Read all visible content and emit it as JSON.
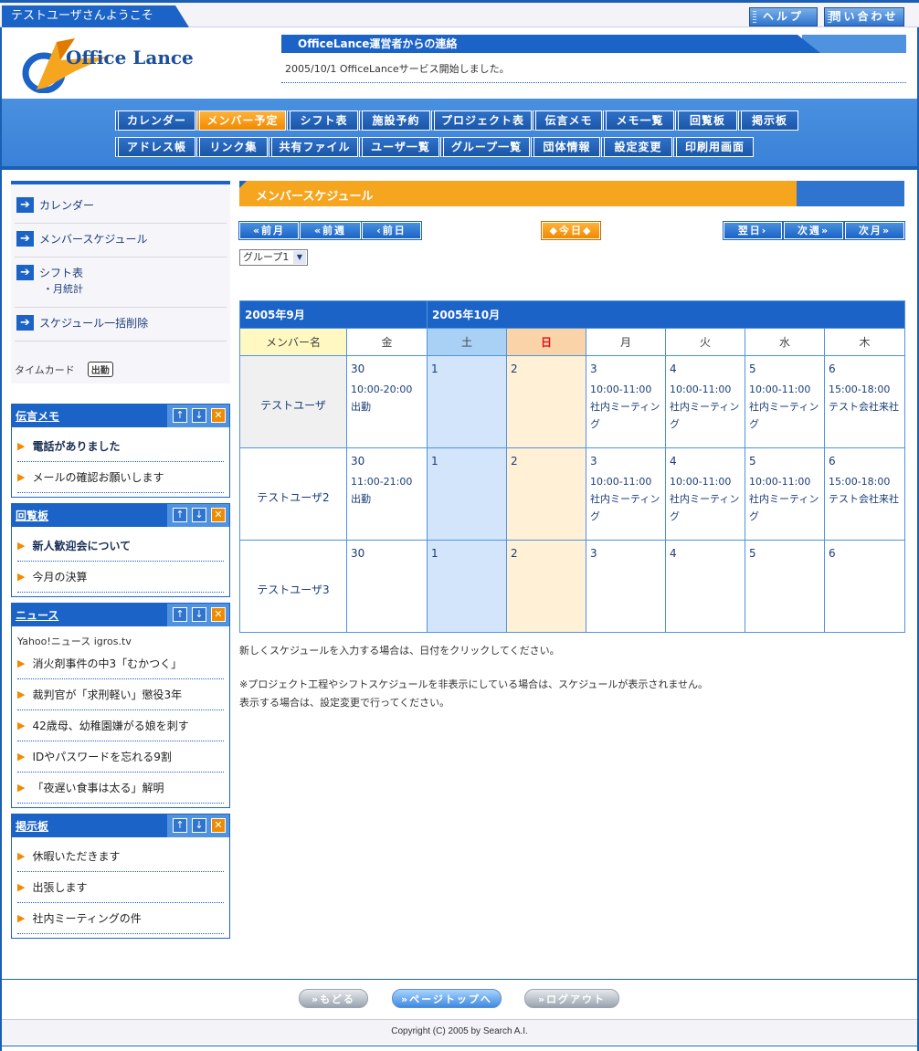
{
  "topbar": {
    "welcome": "テストユーザさんようこそ",
    "help_label": "ヘルプ",
    "contact_label": "問い合わせ"
  },
  "header": {
    "logo_text": "Office Lance",
    "notice_title": "OfficeLance運営者からの連絡",
    "notice_text": "2005/10/1 OfficeLanceサービス開始しました。"
  },
  "nav": {
    "row1": [
      "カレンダー",
      "メンバー予定",
      "シフト表",
      "施設予約",
      "プロジェクト表",
      "伝言メモ",
      "メモ一覧",
      "回覧板",
      "掲示板"
    ],
    "row2": [
      "アドレス帳",
      "リンク集",
      "共有ファイル",
      "ユーザ一覧",
      "グループ一覧",
      "団体情報",
      "設定変更",
      "印刷用画面"
    ],
    "active": "メンバー予定"
  },
  "sidebar": {
    "links": [
      {
        "label": "カレンダー"
      },
      {
        "label": "メンバースケジュール"
      },
      {
        "label": "シフト表",
        "sub": "・月統計"
      },
      {
        "label": "スケジュール一括削除"
      }
    ],
    "timecard_label": "タイムカード",
    "timecard_button": "出勤",
    "panels": [
      {
        "title": "伝言メモ",
        "items": [
          {
            "text": "電話がありました",
            "bold": true
          },
          {
            "text": "メールの確認お願いします",
            "bold": false
          }
        ]
      },
      {
        "title": "回覧板",
        "items": [
          {
            "text": "新人歓迎会について",
            "bold": true
          },
          {
            "text": "今月の決算",
            "bold": false
          }
        ]
      },
      {
        "title": "ニュース",
        "source": "Yahoo!ニュース igros.tv",
        "items": [
          {
            "text": "消火剤事件の中3「むかつく」",
            "bold": false
          },
          {
            "text": "裁判官が「求刑軽い」懲役3年",
            "bold": false
          },
          {
            "text": "42歳母、幼稚園嫌がる娘を刺す",
            "bold": false
          },
          {
            "text": "IDやパスワードを忘れる9割",
            "bold": false
          },
          {
            "text": "「夜遅い食事は太る」解明",
            "bold": false
          }
        ]
      },
      {
        "title": "掲示板",
        "items": [
          {
            "text": "休暇いただきます",
            "bold": false
          },
          {
            "text": "出張します",
            "bold": false
          },
          {
            "text": "社内ミーティングの件",
            "bold": false
          }
        ]
      }
    ]
  },
  "main": {
    "title": "メンバースケジュール",
    "pager": {
      "prev_month": "前月",
      "prev_week": "前週",
      "prev_day": "前日",
      "today": "今日",
      "next_day": "翌日",
      "next_week": "次週",
      "next_month": "次月"
    },
    "group_select": "グループ1",
    "table": {
      "month1": "2005年9月",
      "month2": "2005年10月",
      "name_header": "メンバー名",
      "days": [
        "金",
        "土",
        "日",
        "月",
        "火",
        "水",
        "木"
      ],
      "rows": [
        {
          "name": "テストユーザ",
          "cells": [
            {
              "d": "30",
              "e": "10:00-20:00 出勤"
            },
            {
              "d": "1",
              "e": ""
            },
            {
              "d": "2",
              "e": ""
            },
            {
              "d": "3",
              "e": "10:00-11:00 社内ミーティング"
            },
            {
              "d": "4",
              "e": "10:00-11:00 社内ミーティング"
            },
            {
              "d": "5",
              "e": "10:00-11:00 社内ミーティング"
            },
            {
              "d": "6",
              "e": "15:00-18:00 テスト会社来社"
            }
          ]
        },
        {
          "name": "テストユーザ2",
          "cells": [
            {
              "d": "30",
              "e": "11:00-21:00 出勤"
            },
            {
              "d": "1",
              "e": ""
            },
            {
              "d": "2",
              "e": ""
            },
            {
              "d": "3",
              "e": "10:00-11:00 社内ミーティング"
            },
            {
              "d": "4",
              "e": "10:00-11:00 社内ミーティング"
            },
            {
              "d": "5",
              "e": "10:00-11:00 社内ミーティング"
            },
            {
              "d": "6",
              "e": "15:00-18:00 テスト会社来社"
            }
          ]
        },
        {
          "name": "テストユーザ3",
          "cells": [
            {
              "d": "30",
              "e": ""
            },
            {
              "d": "1",
              "e": ""
            },
            {
              "d": "2",
              "e": ""
            },
            {
              "d": "3",
              "e": ""
            },
            {
              "d": "4",
              "e": ""
            },
            {
              "d": "5",
              "e": ""
            },
            {
              "d": "6",
              "e": ""
            }
          ]
        }
      ]
    },
    "note1": "新しくスケジュールを入力する場合は、日付をクリックしてください。",
    "note2": "※プロジェクト工程やシフトスケジュールを非表示にしている場合は、スケジュールが表示されません。",
    "note3": "表示する場合は、設定変更で行ってください。"
  },
  "footer": {
    "back": "もどる",
    "top": "ページトップへ",
    "logout": "ログアウト",
    "copyright": "Copyright (C) 2005 by Search A.I."
  },
  "colors": {
    "brand_blue": "#1b63c6",
    "accent_orange": "#f08a00",
    "saturday": "#a9d0f5",
    "sunday": "#fbd3a8"
  }
}
